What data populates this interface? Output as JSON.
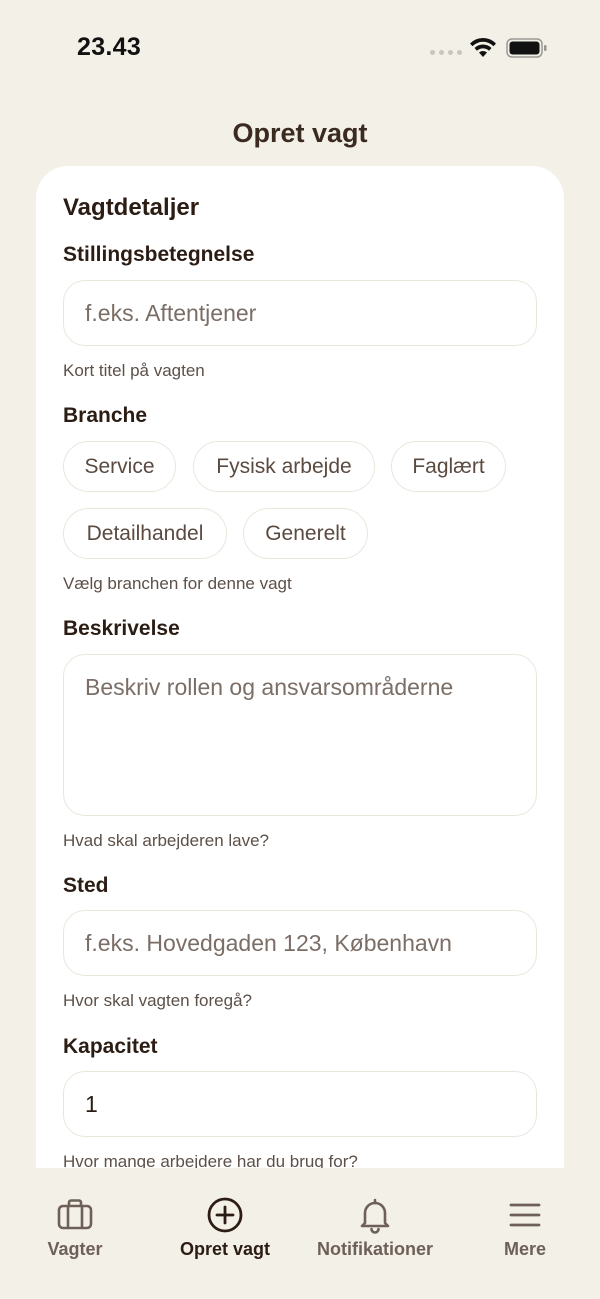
{
  "status_bar": {
    "time": "23.43"
  },
  "header": {
    "title": "Opret vagt"
  },
  "form": {
    "section_title": "Vagtdetaljer",
    "job_title": {
      "label": "Stillingsbetegnelse",
      "placeholder": "f.eks. Aftentjener",
      "helper": "Kort titel på vagten"
    },
    "industry": {
      "label": "Branche",
      "options": [
        "Service",
        "Fysisk arbejde",
        "Faglært",
        "Detailhandel",
        "Generelt"
      ],
      "helper": "Vælg branchen for denne vagt"
    },
    "description": {
      "label": "Beskrivelse",
      "placeholder": "Beskriv rollen og ansvarsområderne",
      "helper": "Hvad skal arbejderen lave?"
    },
    "location": {
      "label": "Sted",
      "placeholder": "f.eks. Hovedgaden 123, København",
      "helper": "Hvor skal vagten foregå?"
    },
    "capacity": {
      "label": "Kapacitet",
      "value": "1",
      "helper": "Hvor mange arbejdere har du brug for?"
    }
  },
  "tab_bar": {
    "items": [
      {
        "label": "Vagter",
        "icon": "briefcase-icon"
      },
      {
        "label": "Opret vagt",
        "icon": "plus-circle-icon",
        "active": true
      },
      {
        "label": "Notifikationer",
        "icon": "bell-icon"
      },
      {
        "label": "Mere",
        "icon": "menu-icon"
      }
    ]
  },
  "colors": {
    "background": "#f3f0e8",
    "card": "#ffffff",
    "text_primary": "#2b1d14",
    "text_secondary": "#5c5048",
    "border": "#ebe6dc"
  }
}
